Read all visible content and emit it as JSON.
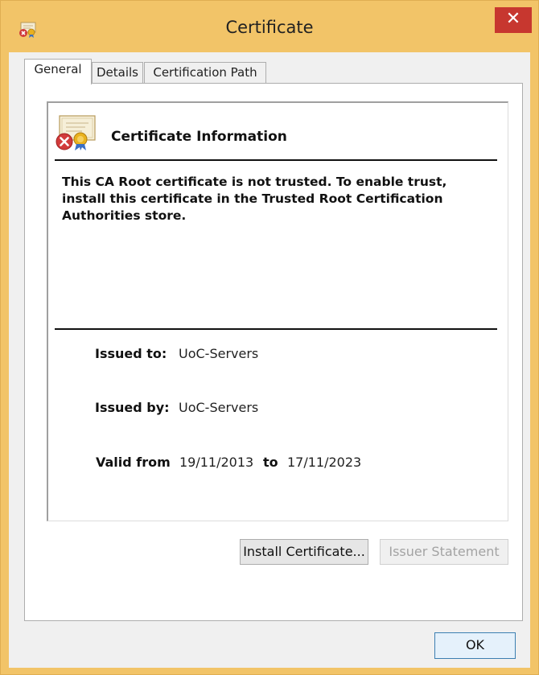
{
  "window": {
    "title": "Certificate",
    "close_glyph": "✕",
    "title_icon": "certificate-error-icon"
  },
  "tabs": [
    {
      "label": "General",
      "active": true
    },
    {
      "label": "Details",
      "active": false
    },
    {
      "label": "Certification Path",
      "active": false
    }
  ],
  "info": {
    "heading": "Certificate Information",
    "icon": "certificate-error-icon",
    "warning": "This CA Root certificate is not trusted. To enable trust, install this certificate in the Trusted Root Certification Authorities store."
  },
  "fields": {
    "issued_to_label": "Issued to:",
    "issued_to_value": "UoC-Servers",
    "issued_by_label": "Issued by:",
    "issued_by_value": "UoC-Servers",
    "valid_from_label": "Valid from",
    "valid_from_value": "19/11/2013",
    "valid_to_label": "to",
    "valid_to_value": "17/11/2023"
  },
  "buttons": {
    "install": "Install Certificate...",
    "issuer": "Issuer Statement",
    "ok": "OK"
  },
  "colors": {
    "title_bar": "#f2c468",
    "close_button": "#c7372f",
    "ok_border": "#3c7fb1"
  }
}
